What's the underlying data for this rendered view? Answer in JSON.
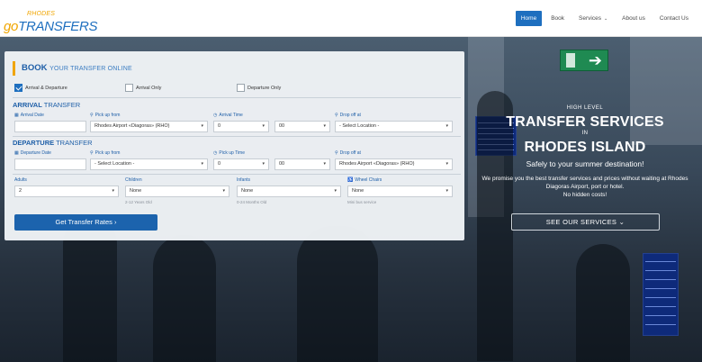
{
  "logo": {
    "top": "RHODES",
    "go": "go",
    "main": "TRANSFERS"
  },
  "nav": [
    {
      "label": "Home",
      "active": true
    },
    {
      "label": "Book"
    },
    {
      "label": "Services",
      "dropdown": true
    },
    {
      "label": "About us"
    },
    {
      "label": "Contact Us"
    }
  ],
  "nav_chevron": "⌄",
  "panel": {
    "title_bold": "BOOK",
    "title_rest": "YOUR TRANSFER ONLINE",
    "options": [
      {
        "label": "Arrival & Departure",
        "checked": true
      },
      {
        "label": "Arrival Only",
        "checked": false
      },
      {
        "label": "Departure Only",
        "checked": false
      }
    ],
    "arrival": {
      "heading_bold": "ARRIVAL",
      "heading_rest": "TRANSFER",
      "date_label": "Arrival Date",
      "date_value": "",
      "pickup_label": "Pick up from",
      "pickup_value": "Rhodes Airport «Diagoras» (RHO)",
      "time_label": "Arrival Time",
      "hour": "0",
      "minute": "00",
      "dropoff_label": "Drop off at",
      "dropoff_value": "- Select Location -"
    },
    "departure": {
      "heading_bold": "DEPARTURE",
      "heading_rest": "TRANSFER",
      "date_label": "Departure Date",
      "date_value": "",
      "pickup_label": "Pick up from",
      "pickup_value": "- Select Location -",
      "time_label": "Pick up Time",
      "hour": "0",
      "minute": "00",
      "dropoff_label": "Drop off at",
      "dropoff_value": "Rhodes Airport «Diagoras» (RHO)"
    },
    "passengers": {
      "adults_label": "Adults",
      "adults_value": "2",
      "children_label": "Children",
      "children_value": "None",
      "children_hint": "2-12 Years Old",
      "infants_label": "Infants",
      "infants_value": "None",
      "infants_hint": "0-24 Months Old",
      "wheel_label": "Wheel Chairs",
      "wheel_value": "None",
      "wheel_hint": "Mini bus service"
    },
    "cta_label": "Get Transfer Rates",
    "cta_arrow": "›"
  },
  "icons": {
    "calendar": "▦",
    "pin": "⚲",
    "clock": "◷",
    "wheelchair": "♿",
    "caret": "▾"
  },
  "hero": {
    "kicker": "HIGH LEVEL",
    "headline1": "TRANSFER SERVICES",
    "in": "IN",
    "headline2": "RHODES ISLAND",
    "tagline": "Safely to your summer destination!",
    "para1": "We promise you the best transfer services and prices without waiting at Rhodes",
    "para2": "Diagoras Airport, port or hotel.",
    "para3": "No hidden costs!",
    "button_label": "SEE OUR SERVICES",
    "button_chevron": "⌄"
  },
  "colors": {
    "brand_blue": "#1e6fbf",
    "accent_orange": "#f0a500",
    "button_blue": "#1c63ad"
  }
}
